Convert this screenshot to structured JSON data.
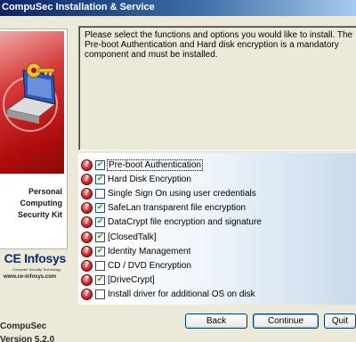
{
  "window": {
    "title": "CompuSec Installation & Service"
  },
  "sidebar": {
    "product_name_line1": "Personal Computing",
    "product_name_line2": "Security Kit",
    "logo_text": "CE Infosys",
    "logo_tagline": "Computer Security Technology",
    "logo_url": "www.ce-infosys.com",
    "brand_name": "CompuSec",
    "version": "Version 5.2.0"
  },
  "description": "Please select the functions and options you would like to install. The Pre-boot Authentication and Hard disk encryption is a mandatory component and must be installed.",
  "options": [
    {
      "label": "Pre-boot Authentication",
      "checked": true,
      "focused": true
    },
    {
      "label": "Hard Disk Encryption",
      "checked": true
    },
    {
      "label": "Single Sign On using user credentials",
      "checked": false
    },
    {
      "label": "SafeLan transparent file encryption",
      "checked": true
    },
    {
      "label": "DataCrypt file encryption and signature",
      "checked": true
    },
    {
      "label": "[ClosedTalk]",
      "checked": true
    },
    {
      "label": "Identity Management",
      "checked": true
    },
    {
      "label": "CD / DVD Encryption",
      "checked": false
    },
    {
      "label": "[DriveCrypt]",
      "checked": true
    },
    {
      "label": "Install driver for additional OS on disk",
      "checked": false
    }
  ],
  "icons": {
    "help": "help-icon",
    "check": "✔",
    "help_glyph": "?"
  },
  "buttons": {
    "back": "Back",
    "continue": "Continue",
    "quit": "Quit"
  },
  "colors": {
    "accent_red": "#c01010",
    "panel_blue": "#c6d8ea",
    "button_border": "#003c74"
  }
}
